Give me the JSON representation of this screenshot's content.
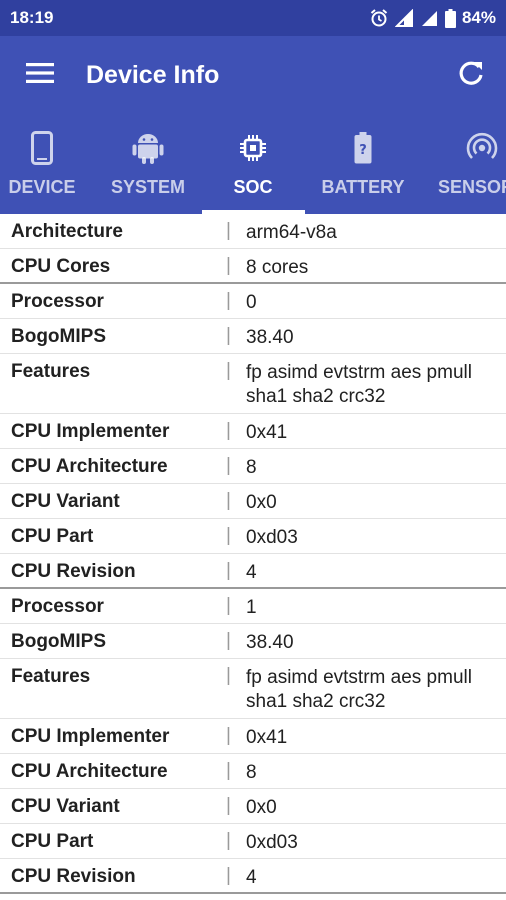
{
  "status_bar": {
    "time": "18:19",
    "battery_percent": "84%",
    "icons": [
      "alarm-icon",
      "signal-icon",
      "signal-icon",
      "battery-icon"
    ]
  },
  "app_bar": {
    "title": "Device Info",
    "menu_icon": "menu-icon",
    "refresh_icon": "refresh-icon"
  },
  "tabs": [
    {
      "label": "DEVICE",
      "icon": "phone-icon",
      "active": false
    },
    {
      "label": "SYSTEM",
      "icon": "android-icon",
      "active": false
    },
    {
      "label": "SOC",
      "icon": "chip-icon",
      "active": true
    },
    {
      "label": "BATTERY",
      "icon": "battery-icon",
      "active": false
    },
    {
      "label": "SENSORS",
      "icon": "sensor-icon",
      "active": false
    }
  ],
  "rows": [
    {
      "label": "Architecture",
      "value": "arm64-v8a"
    },
    {
      "label": "CPU Cores",
      "value": "8 cores"
    },
    {
      "label": "Processor",
      "value": "0"
    },
    {
      "label": "BogoMIPS",
      "value": "38.40"
    },
    {
      "label": "Features",
      "value": "fp asimd evtstrm aes pmull sha1 sha2 crc32"
    },
    {
      "label": "CPU Implementer",
      "value": "0x41"
    },
    {
      "label": "CPU Architecture",
      "value": "8"
    },
    {
      "label": "CPU Variant",
      "value": "0x0"
    },
    {
      "label": "CPU Part",
      "value": "0xd03"
    },
    {
      "label": "CPU Revision",
      "value": "4"
    },
    {
      "label": "Processor",
      "value": "1"
    },
    {
      "label": "BogoMIPS",
      "value": "38.40"
    },
    {
      "label": "Features",
      "value": "fp asimd evtstrm aes pmull sha1 sha2 crc32"
    },
    {
      "label": "CPU Implementer",
      "value": "0x41"
    },
    {
      "label": "CPU Architecture",
      "value": "8"
    },
    {
      "label": "CPU Variant",
      "value": "0x0"
    },
    {
      "label": "CPU Part",
      "value": "0xd03"
    },
    {
      "label": "CPU Revision",
      "value": "4"
    }
  ],
  "colors": {
    "status_bar": "#30409f",
    "app_bar": "#3f51b5",
    "text": "#212121",
    "separator": "#9a9a9a"
  }
}
